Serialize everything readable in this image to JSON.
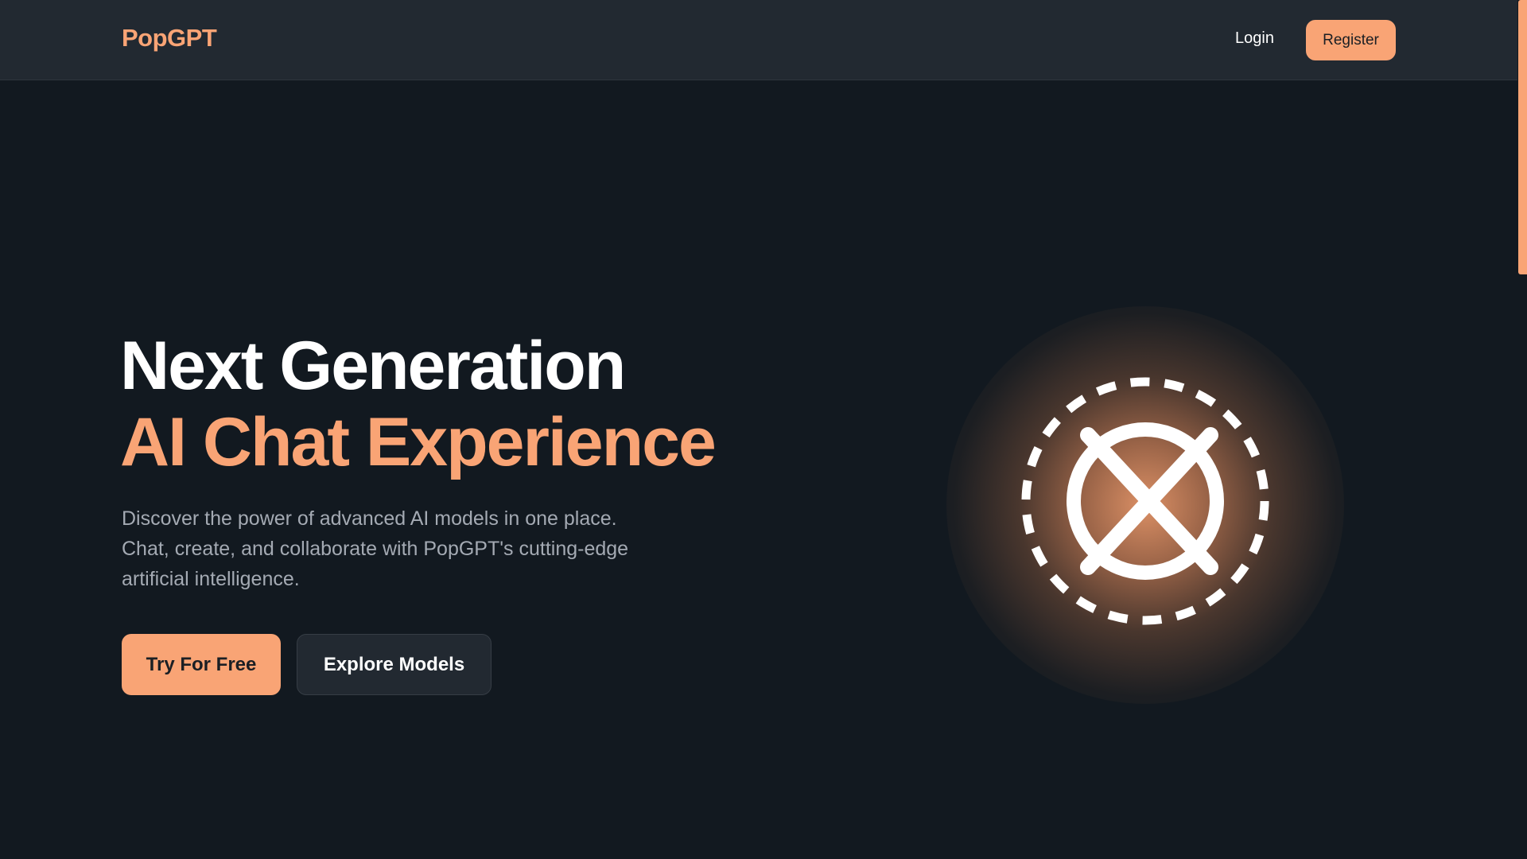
{
  "header": {
    "logo": "PopGPT",
    "login_label": "Login",
    "register_label": "Register"
  },
  "hero": {
    "title_line1": "Next Generation",
    "title_line2": "AI Chat Experience",
    "description": "Discover the power of advanced AI models in one place. Chat, create, and collaborate with PopGPT's cutting-edge artificial intelligence.",
    "primary_button": "Try For Free",
    "secondary_button": "Explore Models",
    "emblem_icon": "dashed-circle-x-logo-icon"
  },
  "colors": {
    "accent": "#f9a475",
    "background": "#121920",
    "header_bg": "#222931",
    "text_muted": "#a4aab3"
  }
}
